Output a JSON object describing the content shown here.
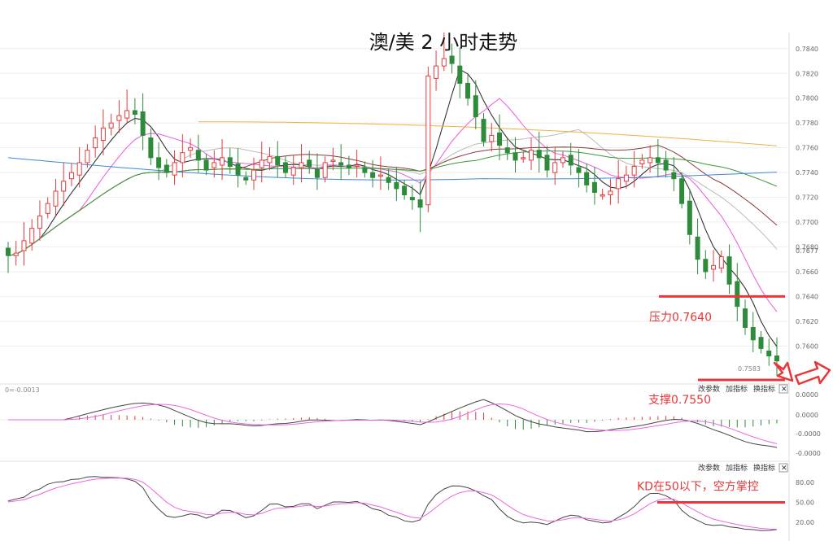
{
  "title": "澳/美 2 小时走势",
  "colors": {
    "up": "#e8393c",
    "down": "#2e8b3a",
    "annotation": "#e8363a",
    "ma5": "#333333",
    "ma10": "#ee66dd",
    "ma20": "#bbbbbb",
    "ma30": "#8b3a3a",
    "ma60": "#3a9a3a",
    "ma120": "#3a8ad6",
    "ma250": "#f0b040"
  },
  "chart_data": [
    {
      "type": "candlestick",
      "panel": "price",
      "title": "澳/美 2 小时走势",
      "ylim": [
        0.7572,
        0.7853
      ],
      "yticks": [
        "0.7840",
        "0.7820",
        "0.7800",
        "0.7780",
        "0.7760",
        "0.7740",
        "0.7720",
        "0.7700",
        "0.7680",
        "0.7660",
        "0.7640",
        "0.7620",
        "0.7600"
      ],
      "last_price_tag": "0.7677",
      "low_label": "0.7583",
      "closes": [
        0.7673,
        0.7675,
        0.7685,
        0.7695,
        0.7705,
        0.7715,
        0.7725,
        0.7733,
        0.774,
        0.7748,
        0.7758,
        0.7768,
        0.7776,
        0.778,
        0.7786,
        0.779,
        0.7787,
        0.777,
        0.7752,
        0.7744,
        0.774,
        0.7748,
        0.7756,
        0.776,
        0.775,
        0.7742,
        0.7748,
        0.7752,
        0.7745,
        0.7738,
        0.7734,
        0.7742,
        0.775,
        0.7753,
        0.7746,
        0.774,
        0.7744,
        0.7748,
        0.7745,
        0.7736,
        0.7748,
        0.775,
        0.7746,
        0.7744,
        0.7746,
        0.774,
        0.7736,
        0.7738,
        0.7732,
        0.7727,
        0.7722,
        0.7718,
        0.7712,
        0.7818,
        0.7826,
        0.7832,
        0.7828,
        0.7812,
        0.78,
        0.7785,
        0.7765,
        0.777,
        0.7762,
        0.7756,
        0.775,
        0.7752,
        0.7758,
        0.7752,
        0.7742,
        0.7748,
        0.7752,
        0.7746,
        0.774,
        0.773,
        0.7724,
        0.7722,
        0.7725,
        0.7735,
        0.7738,
        0.7745,
        0.775,
        0.7752,
        0.7748,
        0.7742,
        0.7735,
        0.7715,
        0.769,
        0.767,
        0.766,
        0.7665,
        0.7672,
        0.765,
        0.7632,
        0.7615,
        0.7605,
        0.7598,
        0.7592,
        0.7588
      ],
      "moving_averages": [
        "MA5",
        "MA10",
        "MA20",
        "MA30",
        "MA60",
        "MA120",
        "MA250"
      ],
      "annotations": [
        {
          "text": "压力0.7640",
          "price": 0.764
        },
        {
          "text": "支撑0.7550",
          "price": 0.755
        }
      ]
    },
    {
      "type": "macd",
      "panel": "macd",
      "header": "0=-0.0013",
      "yticks": [
        "0.0000",
        "0.0000",
        "-0.0000",
        "-0.0000"
      ]
    },
    {
      "type": "kd",
      "panel": "kd",
      "yticks": [
        "80.00",
        "50.00",
        "20.00"
      ],
      "annotation": {
        "text": "KD在50以下，空方掌控",
        "level": 50
      }
    }
  ],
  "toolbar": {
    "params": "改参数",
    "add_indicator": "加指标",
    "switch_indicator": "换指标",
    "close": "✕"
  }
}
